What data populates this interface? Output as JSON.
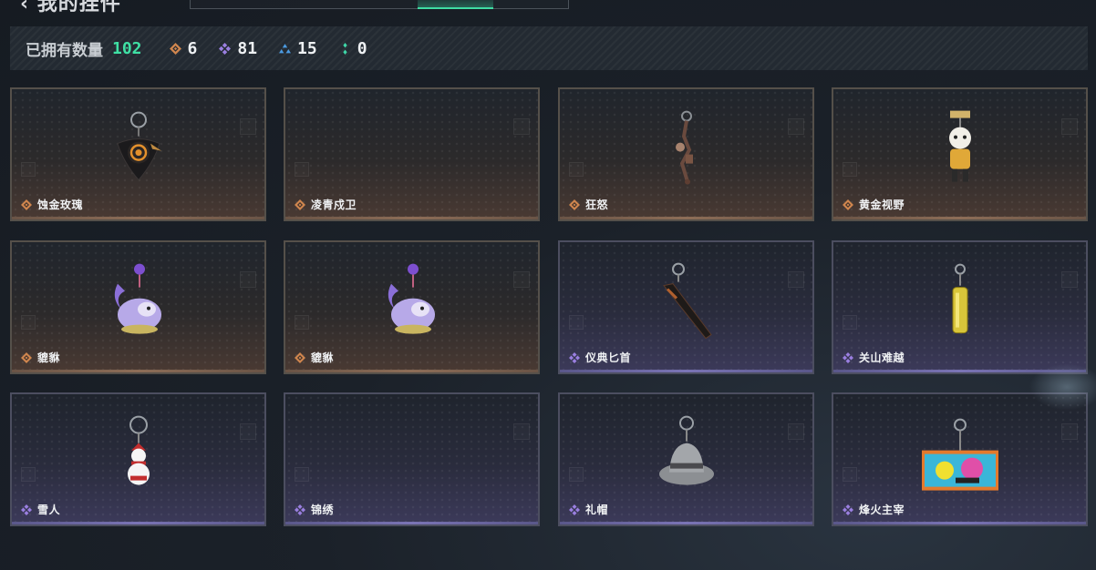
{
  "header": {
    "title": "我的挂件"
  },
  "stats": {
    "owned_label": "已拥有数量",
    "owned_total": "102",
    "rarities": [
      {
        "icon": "orange-diamond-icon",
        "color": "#d0864e",
        "count": "6"
      },
      {
        "icon": "purple-clover-icon",
        "color": "#9a7fe0",
        "count": "81"
      },
      {
        "icon": "blue-triangle-icon",
        "color": "#4b9be2",
        "count": "15"
      },
      {
        "icon": "green-dots-icon",
        "color": "#3fd6a8",
        "count": "0"
      }
    ]
  },
  "items": [
    {
      "name": "蚀金玫瑰",
      "rarity": "orange",
      "icon": "rose-charm-icon"
    },
    {
      "name": "凌青戍卫",
      "rarity": "orange",
      "icon": "none"
    },
    {
      "name": "狂怒",
      "rarity": "orange",
      "icon": "skull-chain-icon"
    },
    {
      "name": "黄金视野",
      "rarity": "orange",
      "icon": "golden-figure-icon"
    },
    {
      "name": "貔貅",
      "rarity": "orange",
      "icon": "purple-pixiu-icon"
    },
    {
      "name": "貔貅",
      "rarity": "orange",
      "icon": "purple-pixiu-icon"
    },
    {
      "name": "仪典匕首",
      "rarity": "purple",
      "icon": "dagger-icon"
    },
    {
      "name": "关山难越",
      "rarity": "purple",
      "icon": "gold-capsule-icon"
    },
    {
      "name": "雪人",
      "rarity": "purple",
      "icon": "snowman-icon"
    },
    {
      "name": "锦绣",
      "rarity": "purple",
      "icon": "none"
    },
    {
      "name": "礼帽",
      "rarity": "purple",
      "icon": "fedora-hat-icon"
    },
    {
      "name": "烽火主宰",
      "rarity": "purple",
      "icon": "graffiti-container-icon"
    }
  ],
  "colors": {
    "accent": "#3fe0a4",
    "orange": "#d0864e",
    "purple": "#9a7fe0"
  }
}
